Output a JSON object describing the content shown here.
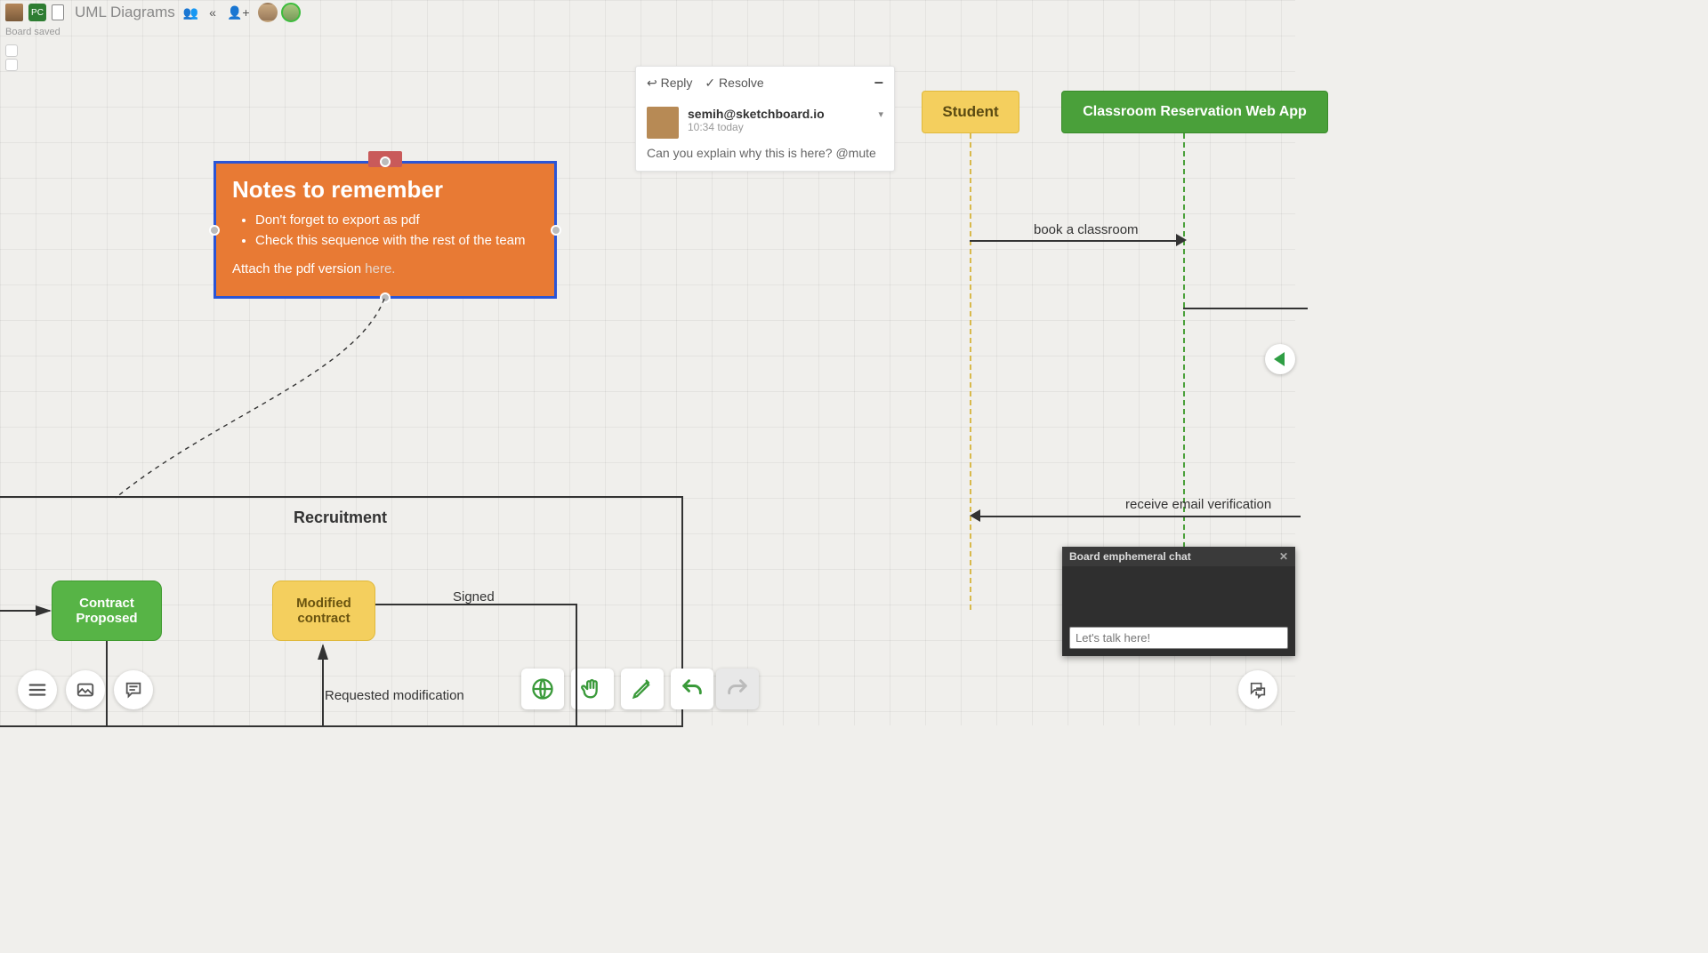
{
  "header": {
    "title": "UML Diagrams",
    "saved_status": "Board saved",
    "user_badge": "PC"
  },
  "note": {
    "title": "Notes to remember",
    "bullets": [
      "Don't forget to export as pdf",
      "Check this sequence with the rest of the team"
    ],
    "attach_prefix": "Attach the pdf version ",
    "attach_link": "here."
  },
  "comment": {
    "reply_label": "Reply",
    "resolve_label": "Resolve",
    "author": "semih@sketchboard.io",
    "timestamp": "10:34 today",
    "message": "Can you explain why this is here? @mute"
  },
  "sequence": {
    "actor_student": "Student",
    "actor_app": "Classroom Reservation Web App",
    "msg_book": "book a classroom",
    "msg_receive": "receive email verification"
  },
  "recruitment": {
    "frame_title": "Recruitment",
    "state_contract": "Contract Proposed",
    "state_modified": "Modified contract",
    "label_signed": "Signed",
    "label_requested": "Requested modification"
  },
  "chat": {
    "title": "Board emphemeral chat",
    "placeholder": "Let's talk here!"
  }
}
